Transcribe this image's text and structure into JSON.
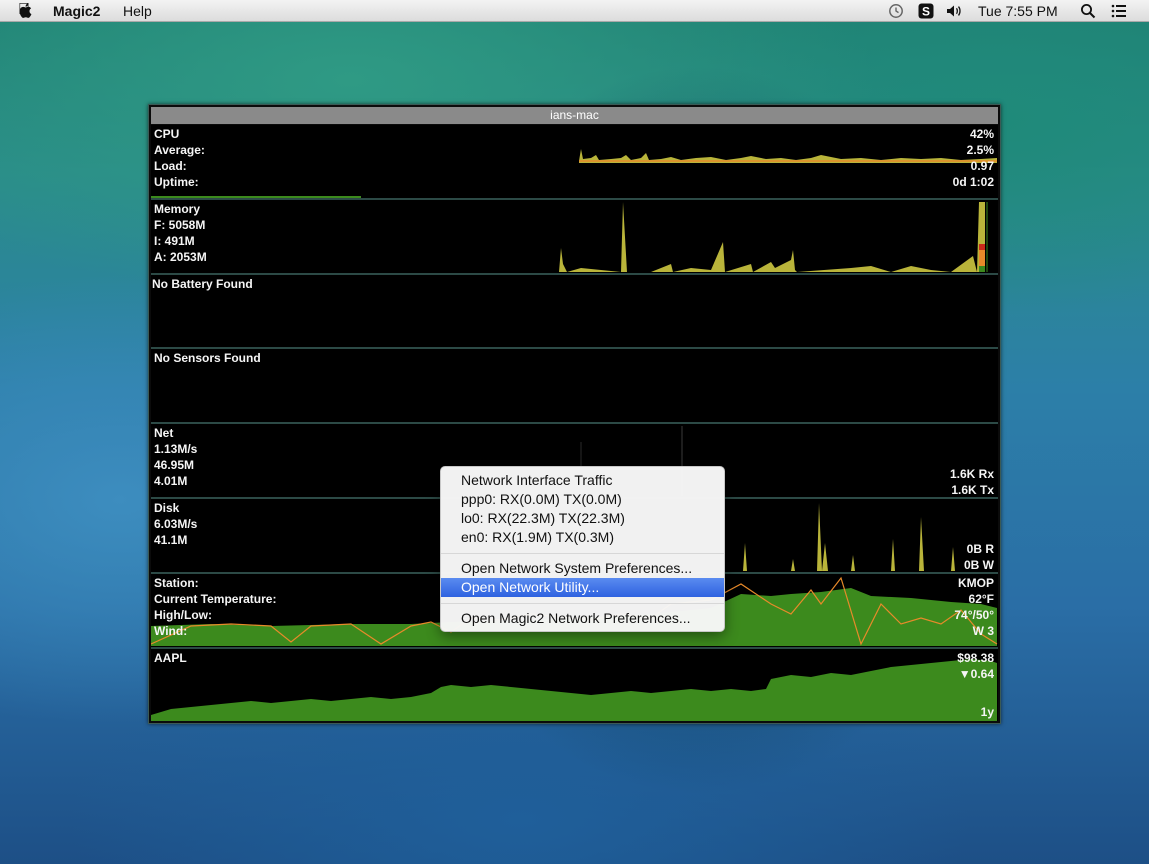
{
  "menubar": {
    "app_name": "Magic2",
    "help": "Help",
    "clock": "Tue 7:55 PM",
    "icons": [
      "apple-icon",
      "time-machine-icon",
      "magic2-status-icon",
      "volume-icon",
      "spotlight-icon",
      "notification-center-icon"
    ]
  },
  "widget": {
    "title": "ians-mac",
    "cpu": {
      "label": "CPU",
      "avg_label": "Average:",
      "load_label": "Load:",
      "uptime_label": "Uptime:",
      "percent": "42%",
      "avg": "2.5%",
      "load": "0.97",
      "uptime": "0d 1:02"
    },
    "memory": {
      "label": "Memory",
      "free": "F: 5058M",
      "inactive": "I: 491M",
      "active": "A: 2053M"
    },
    "battery": {
      "label": "No Battery Found"
    },
    "sensors": {
      "label": "No Sensors Found"
    },
    "net": {
      "label": "Net",
      "rate": "1.13M/s",
      "in": "46.95M",
      "out": "4.01M",
      "rx": "1.6K Rx",
      "tx": "1.6K Tx"
    },
    "disk": {
      "label": "Disk",
      "rate": "6.03M/s",
      "total": "41.1M",
      "read": "0B R",
      "write": "0B W"
    },
    "weather": {
      "station_label": "Station:",
      "temp_label": "Current Temperature:",
      "hilo_label": "High/Low:",
      "wind_label": "Wind:",
      "station": "KMOP",
      "temp": "62°F",
      "hilo": "74°/50°",
      "wind": "W 3"
    },
    "stock": {
      "symbol": "AAPL",
      "price": "$98.38",
      "change": "▼0.64",
      "range": "1y"
    }
  },
  "context_menu": {
    "header": "Network Interface Traffic",
    "interfaces": [
      "ppp0: RX(0.0M) TX(0.0M)",
      "lo0: RX(22.3M) TX(22.3M)",
      "en0: RX(1.9M) TX(0.3M)"
    ],
    "open_sys_prefs": "Open Network System Preferences...",
    "open_utility": "Open Network Utility...",
    "open_magic_prefs": "Open Magic2 Network Preferences..."
  },
  "colors": {
    "graph_green": "#3c8a1d",
    "graph_orange": "#e88a2a",
    "graph_yellow": "#b9b43a",
    "highlight": "#2e62e0"
  }
}
